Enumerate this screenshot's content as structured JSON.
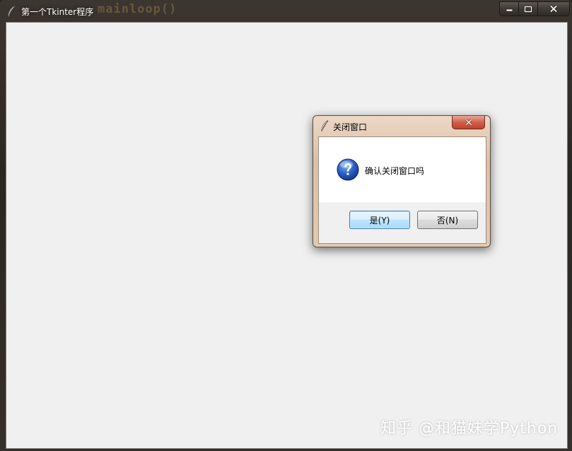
{
  "window": {
    "title": "第一个Tkinter程序",
    "background_code_text": "mainloop()"
  },
  "dialog": {
    "title": "关闭窗口",
    "message": "确认关闭窗口吗",
    "icon": "question-icon",
    "buttons": {
      "yes_label": "是(Y)",
      "no_label": "否(N)"
    }
  },
  "watermark": "知乎 @和猫妹学Python",
  "colors": {
    "client_bg": "#f0f0f0",
    "default_button_border": "#3c7fb1",
    "close_button_red": "#c0402c"
  }
}
